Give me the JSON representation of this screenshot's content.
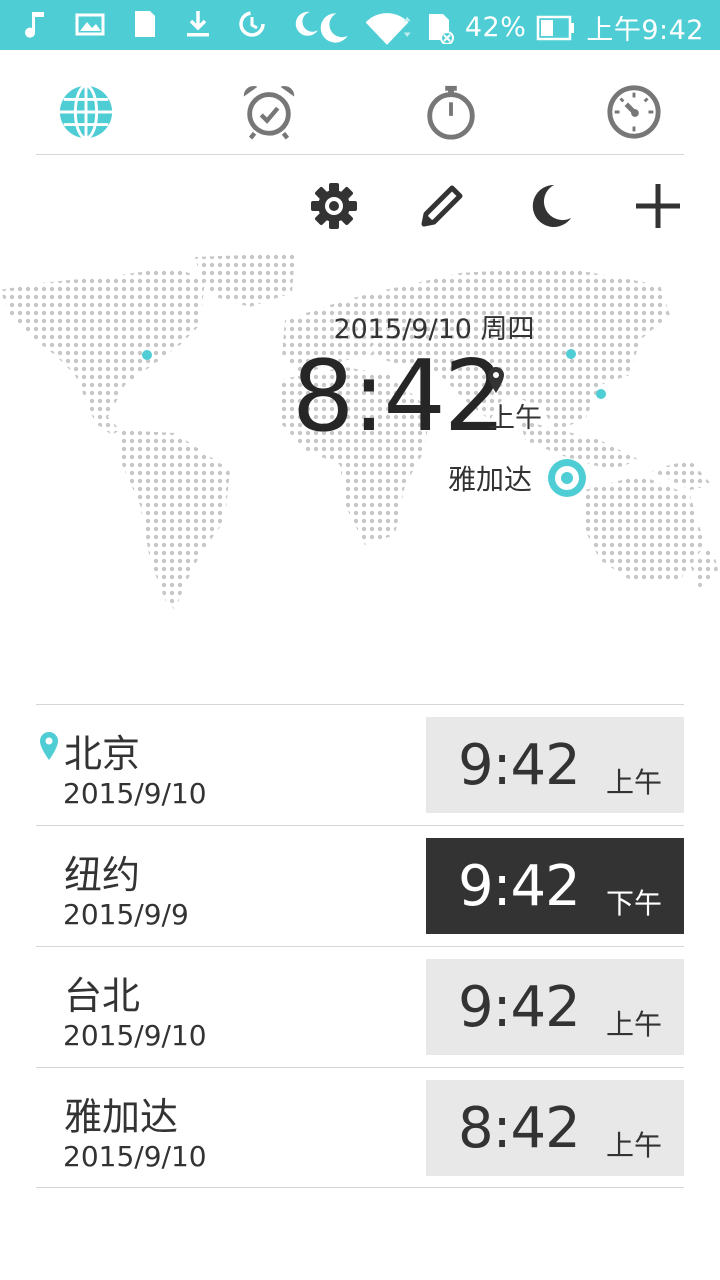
{
  "status_bar": {
    "battery": "42%",
    "time": "上午9:42"
  },
  "colors": {
    "accent": "#4ecdd4",
    "text": "#333333",
    "icon_gray": "#777777",
    "box_light": "#e8e8e8",
    "box_dark": "#333333"
  },
  "tabs": [
    {
      "name": "world-clock",
      "icon": "globe-icon",
      "active": true
    },
    {
      "name": "alarm",
      "icon": "alarm-clock-icon",
      "active": false
    },
    {
      "name": "stopwatch",
      "icon": "stopwatch-icon",
      "active": false
    },
    {
      "name": "timer",
      "icon": "timer-icon",
      "active": false
    }
  ],
  "toolbar": [
    "gear-icon",
    "pencil-icon",
    "moon-icon",
    "plus-icon"
  ],
  "map": {
    "date": "2015/9/10 周四",
    "time": "8:42",
    "ampm": "上午",
    "city": "雅加达"
  },
  "cities": [
    {
      "name": "北京",
      "date": "2015/9/10",
      "time": "9:42",
      "ampm": "上午",
      "dark": false,
      "current": true
    },
    {
      "name": "纽约",
      "date": "2015/9/9",
      "time": "9:42",
      "ampm": "下午",
      "dark": true,
      "current": false
    },
    {
      "name": "台北",
      "date": "2015/9/10",
      "time": "9:42",
      "ampm": "上午",
      "dark": false,
      "current": false
    },
    {
      "name": "雅加达",
      "date": "2015/9/10",
      "time": "8:42",
      "ampm": "上午",
      "dark": false,
      "current": false
    }
  ]
}
